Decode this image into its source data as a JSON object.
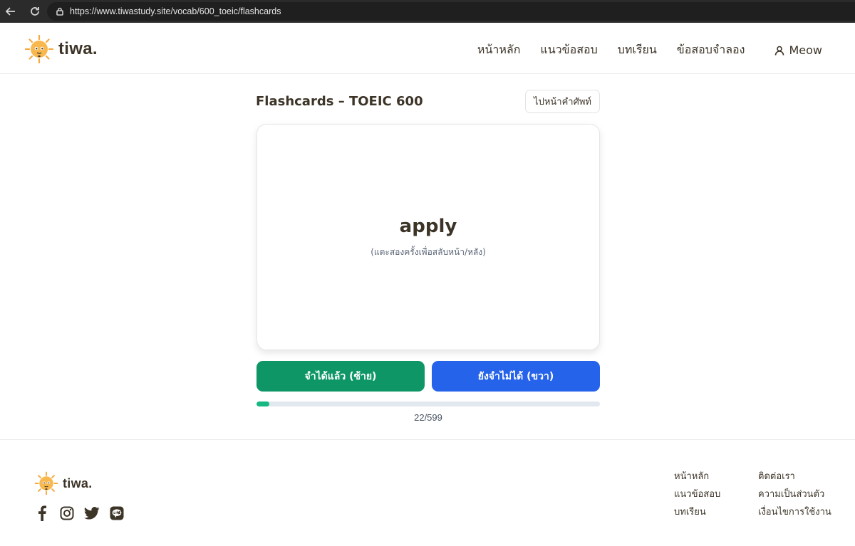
{
  "browser": {
    "url": "https://www.tiwastudy.site/vocab/600_toeic/flashcards"
  },
  "header": {
    "logo_text": "tiwa.",
    "nav": [
      "หน้าหลัก",
      "แนวข้อสอบ",
      "บทเรียน",
      "ข้อสอบจำลอง"
    ],
    "user_name": "Meow"
  },
  "main": {
    "title": "Flashcards – TOEIC 600",
    "dictionary_button": "ไปหน้าคำศัพท์",
    "card": {
      "word": "apply",
      "hint": "(แตะสองครั้งเพื่อสลับหน้า/หลัง)"
    },
    "remembered_button": "จำได้แล้ว (ซ้าย)",
    "not_yet_button": "ยังจำไม่ได้ (ขวา)",
    "progress": {
      "current": 22,
      "total": 599,
      "text": "22/599"
    }
  },
  "footer": {
    "logo_text": "tiwa.",
    "socials": [
      "facebook-icon",
      "instagram-icon",
      "twitter-icon",
      "line-icon"
    ],
    "links_col1": [
      "หน้าหลัก",
      "แนวข้อสอบ",
      "บทเรียน"
    ],
    "links_col2": [
      "ติดต่อเรา",
      "ความเป็นส่วนตัว",
      "เงื่อนไขการใช้งาน"
    ]
  },
  "colors": {
    "remembered": "#0e9667",
    "not_yet": "#2563eb",
    "progress_fill": "#16b981",
    "text": "#3d3428"
  }
}
